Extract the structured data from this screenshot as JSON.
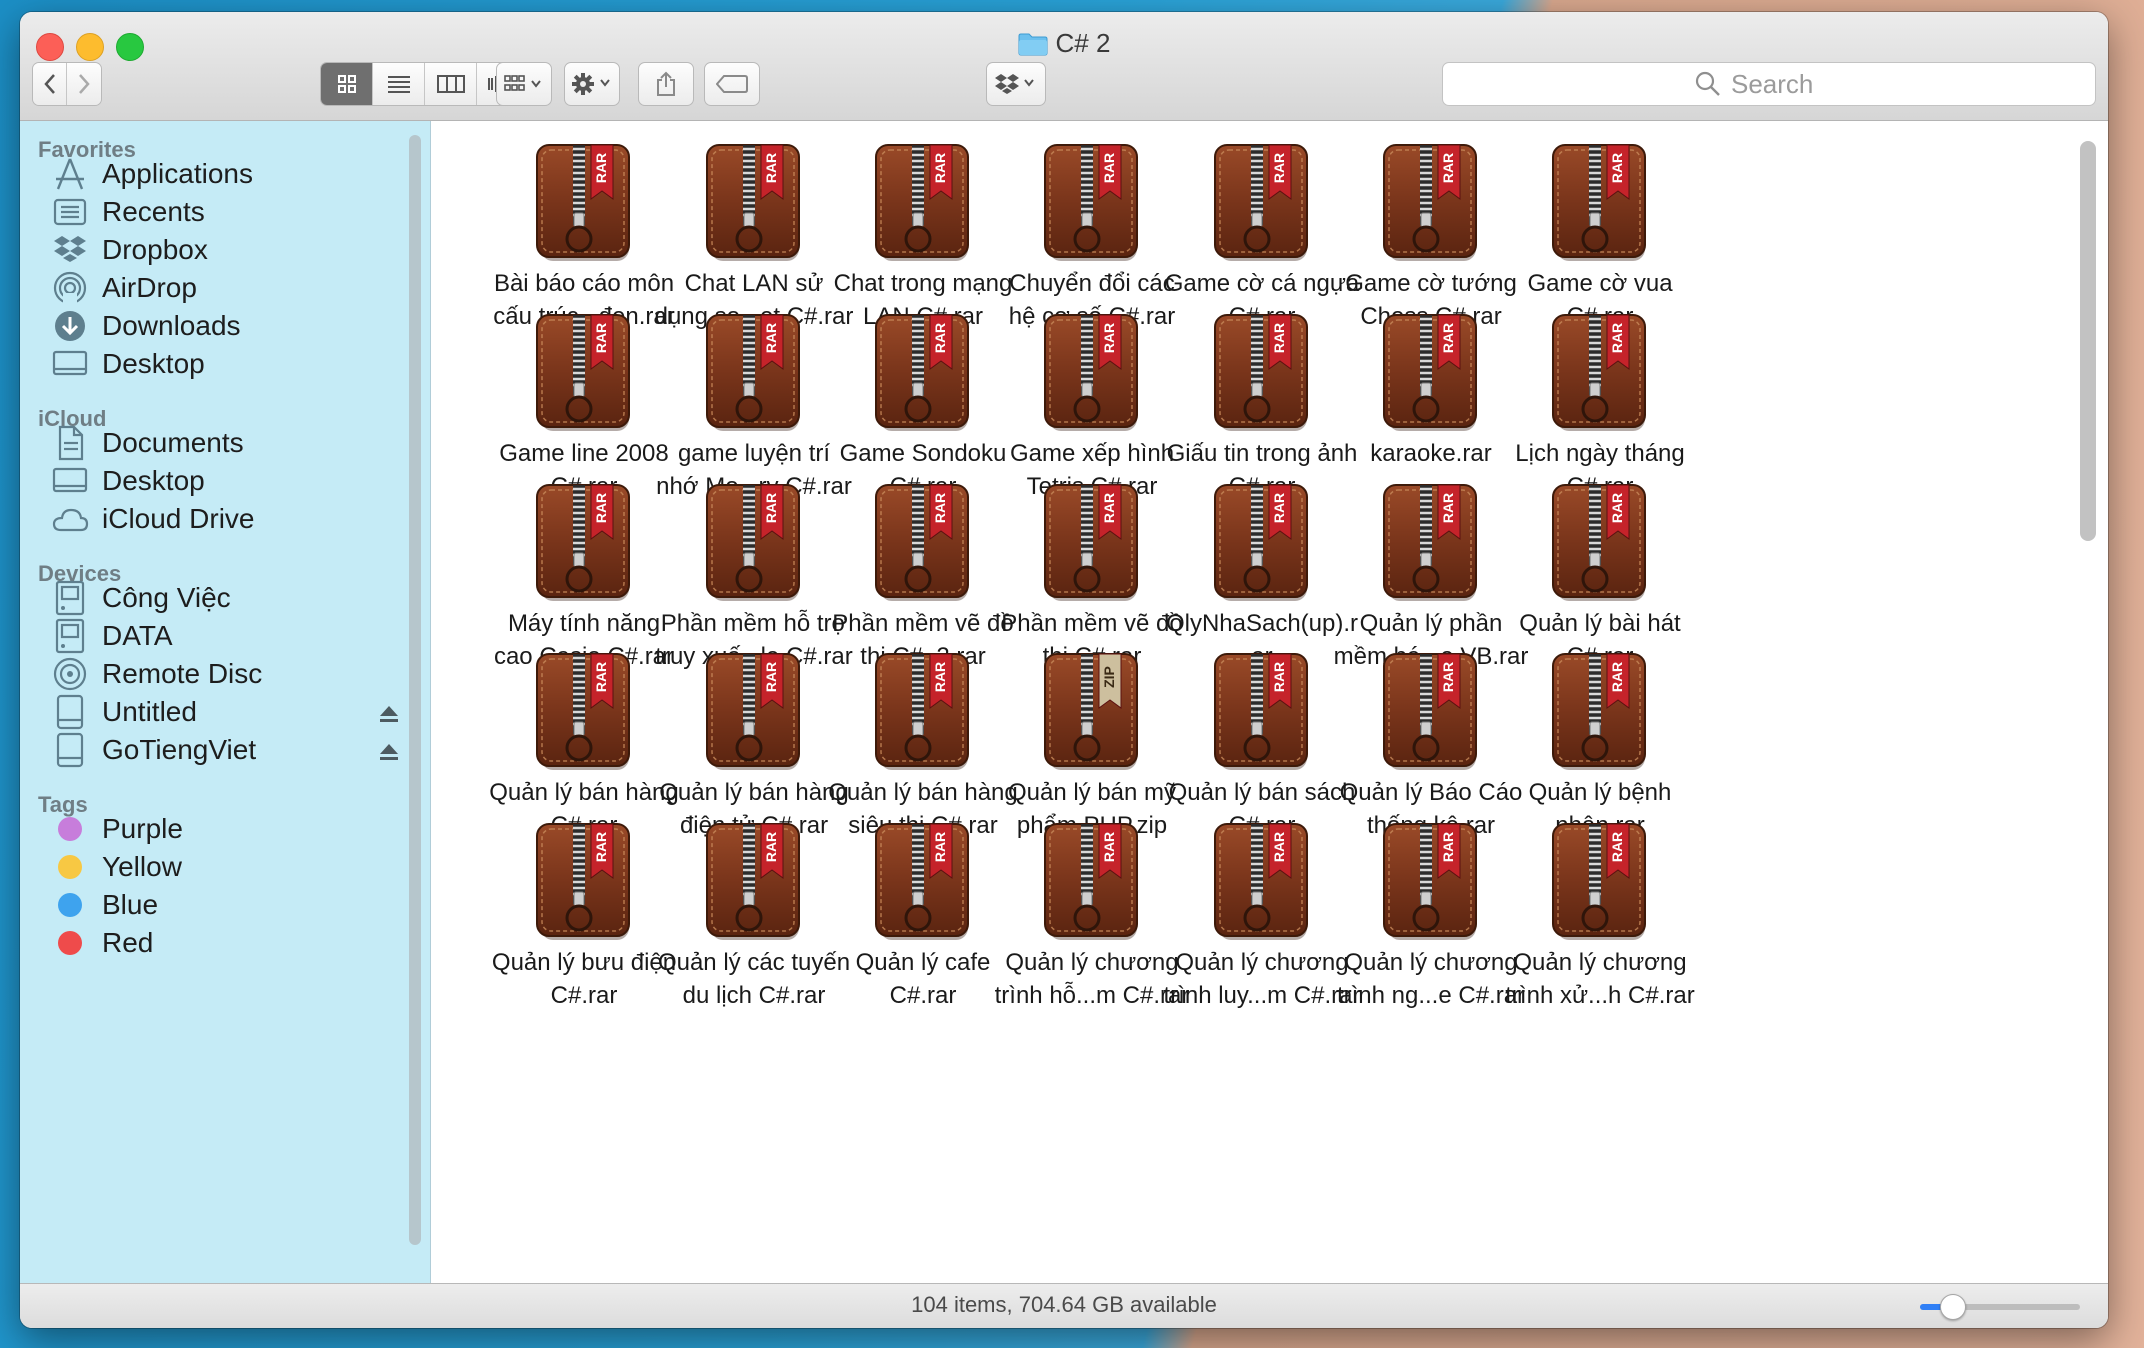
{
  "window": {
    "title": "C# 2"
  },
  "toolbar": {
    "search_placeholder": "Search",
    "icons": [
      "back-icon",
      "forward-icon",
      "icon-view-icon",
      "list-view-icon",
      "column-view-icon",
      "cover-flow-icon",
      "group-by-icon",
      "gear-icon",
      "share-icon",
      "tag-icon",
      "dropbox-icon"
    ]
  },
  "sidebar": {
    "favorites_title": "Favorites",
    "favorites": [
      {
        "label": "Applications",
        "icon": "applications-icon"
      },
      {
        "label": "Recents",
        "icon": "recents-icon"
      },
      {
        "label": "Dropbox",
        "icon": "dropbox-icon"
      },
      {
        "label": "AirDrop",
        "icon": "airdrop-icon"
      },
      {
        "label": "Downloads",
        "icon": "downloads-icon"
      },
      {
        "label": "Desktop",
        "icon": "desktop-icon"
      }
    ],
    "icloud_title": "iCloud",
    "icloud": [
      {
        "label": "Documents",
        "icon": "documents-icon"
      },
      {
        "label": "Desktop",
        "icon": "desktop-icon"
      },
      {
        "label": "iCloud Drive",
        "icon": "cloud-icon"
      }
    ],
    "devices_title": "Devices",
    "devices": [
      {
        "label": "Công Việc",
        "icon": "disk-icon"
      },
      {
        "label": "DATA",
        "icon": "disk-icon"
      },
      {
        "label": "Remote Disc",
        "icon": "disc-icon"
      },
      {
        "label": "Untitled",
        "icon": "drive-icon"
      },
      {
        "label": "GoTiengViet",
        "icon": "drive-icon"
      }
    ],
    "tags_title": "Tags",
    "tags": [
      {
        "label": "Purple",
        "color": "#c77ddb"
      },
      {
        "label": "Yellow",
        "color": "#f7c843"
      },
      {
        "label": "Blue",
        "color": "#3ea3ee"
      },
      {
        "label": "Red",
        "color": "#ef4b4b"
      }
    ]
  },
  "files": [
    {
      "name": "Bài báo cáo môn\ncấu trúc...đen.rar",
      "type": "RAR"
    },
    {
      "name": "Chat LAN sử\ndụng so...et C#.rar",
      "type": "RAR"
    },
    {
      "name": "Chat trong mạng\nLAN C#.rar",
      "type": "RAR"
    },
    {
      "name": "Chuyển đổi các\nhệ cơ số C#.rar",
      "type": "RAR"
    },
    {
      "name": "Game cờ cá ngựa\nC#.rar",
      "type": "RAR"
    },
    {
      "name": "Game cờ tướng\nChess C#.rar",
      "type": "RAR"
    },
    {
      "name": "Game cờ vua\nC#.rar",
      "type": "RAR"
    },
    {
      "name": "Game line 2008\nC#.rar",
      "type": "RAR"
    },
    {
      "name": "game luyện trí\nnhớ Mo...ry C#.rar",
      "type": "RAR"
    },
    {
      "name": "Game Sondoku\nC#.rar",
      "type": "RAR"
    },
    {
      "name": "Game xếp hình\nTetris C#.rar",
      "type": "RAR"
    },
    {
      "name": "Giấu tin trong ảnh\nC#.rar",
      "type": "RAR"
    },
    {
      "name": "karaoke.rar",
      "type": "RAR"
    },
    {
      "name": "Lịch ngày tháng\nC#.rar",
      "type": "RAR"
    },
    {
      "name": "Máy tính năng\ncao Casio C#.rar",
      "type": "RAR"
    },
    {
      "name": "Phần mềm hỗ trợ\ntruy xuấ...le C#.rar",
      "type": "RAR"
    },
    {
      "name": "Phần mềm vẽ đồ\nthị C#_2.rar",
      "type": "RAR"
    },
    {
      "name": "Phần mềm vẽ đồ\nthị C#.rar",
      "type": "RAR"
    },
    {
      "name": "QlyNhaSach(up).r\nar",
      "type": "RAR"
    },
    {
      "name": "Quản lý  phần\nmềm bá...e VB.rar",
      "type": "RAR"
    },
    {
      "name": "Quản lý bài hát\nC#.rar",
      "type": "RAR"
    },
    {
      "name": "Quản lý bán hàng\nC#.rar",
      "type": "RAR"
    },
    {
      "name": "Quản lý bán hàng\nđiện tử C#.rar",
      "type": "RAR"
    },
    {
      "name": "Quản lý bán hàng\nsiêu thị C#.rar",
      "type": "RAR"
    },
    {
      "name": "Quản lý bán mỹ\nphẩm PHP.zip",
      "type": "ZIP"
    },
    {
      "name": "Quản lý bán sách\nC#.rar",
      "type": "RAR"
    },
    {
      "name": "Quản lý Báo Cáo\nthống kê.rar",
      "type": "RAR"
    },
    {
      "name": "Quản lý bệnh\nnhân.rar",
      "type": "RAR"
    },
    {
      "name": "Quản lý bưu điện\nC#.rar",
      "type": "RAR"
    },
    {
      "name": "Quản lý các tuyến\ndu lịch C#.rar",
      "type": "RAR"
    },
    {
      "name": "Quản lý cafe\nC#.rar",
      "type": "RAR"
    },
    {
      "name": "Quản lý chương\ntrình hỗ...m C#.rar",
      "type": "RAR"
    },
    {
      "name": "Quản lý chương\ntrình luy...m C#.rar",
      "type": "RAR"
    },
    {
      "name": "Quản lý chương\ntrình ng...e C#.rar",
      "type": "RAR"
    },
    {
      "name": "Quản lý chương\ntrình xử...h C#.rar",
      "type": "RAR"
    }
  ],
  "status": {
    "text": "104 items, 704.64 GB available",
    "icon_size_level": 0.2
  }
}
